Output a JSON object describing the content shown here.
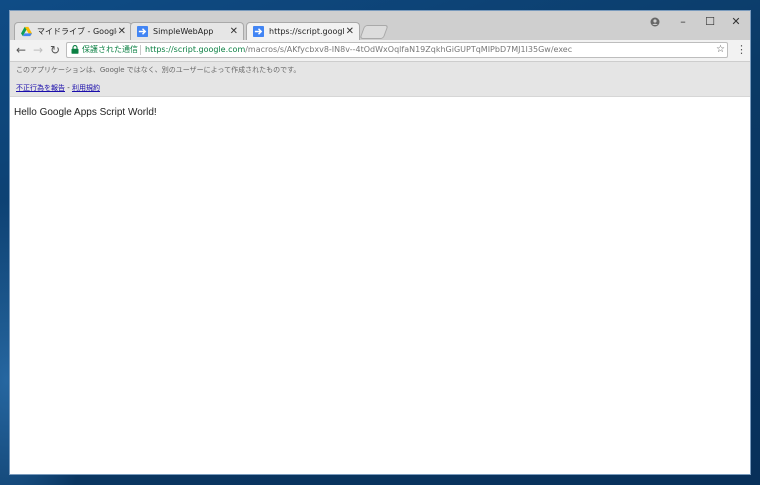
{
  "browser": {
    "tabs": [
      {
        "label": "マイドライブ - Google ドライ",
        "icon": "google-drive-icon",
        "close": "✕"
      },
      {
        "label": "SimpleWebApp",
        "icon": "apps-script-icon",
        "close": "✕"
      },
      {
        "label": "https://script.google.com",
        "icon": "apps-script-icon",
        "close": "✕",
        "active": true
      }
    ],
    "window_controls": {
      "account": "account-icon",
      "minimize": "–",
      "maximize": "☐",
      "close": "✕"
    },
    "nav": {
      "back": "←",
      "forward": "→",
      "reload": "↻"
    },
    "address_bar": {
      "secure_label": "保護された通信",
      "url_host": "https://script.google.com",
      "url_path": "/macros/s/AKfycbxv8-IN8v--4tOdWxOqlfaN19ZqkhGiGUPTqMIPbD7MJ1I35Gw/exec",
      "star": "☆"
    },
    "menu": "⋮"
  },
  "banner": {
    "text": "このアプリケーションは、Google ではなく、別のユーザーによって作成されたものです。",
    "report_link": "不正行為を報告",
    "separator": " - ",
    "terms_link": "利用規約"
  },
  "content": {
    "message": "Hello Google Apps Script World!"
  },
  "colors": {
    "secure_green": "#0b8043",
    "link_blue": "#1a0dab",
    "desktop_blue": "#0b3a66"
  }
}
